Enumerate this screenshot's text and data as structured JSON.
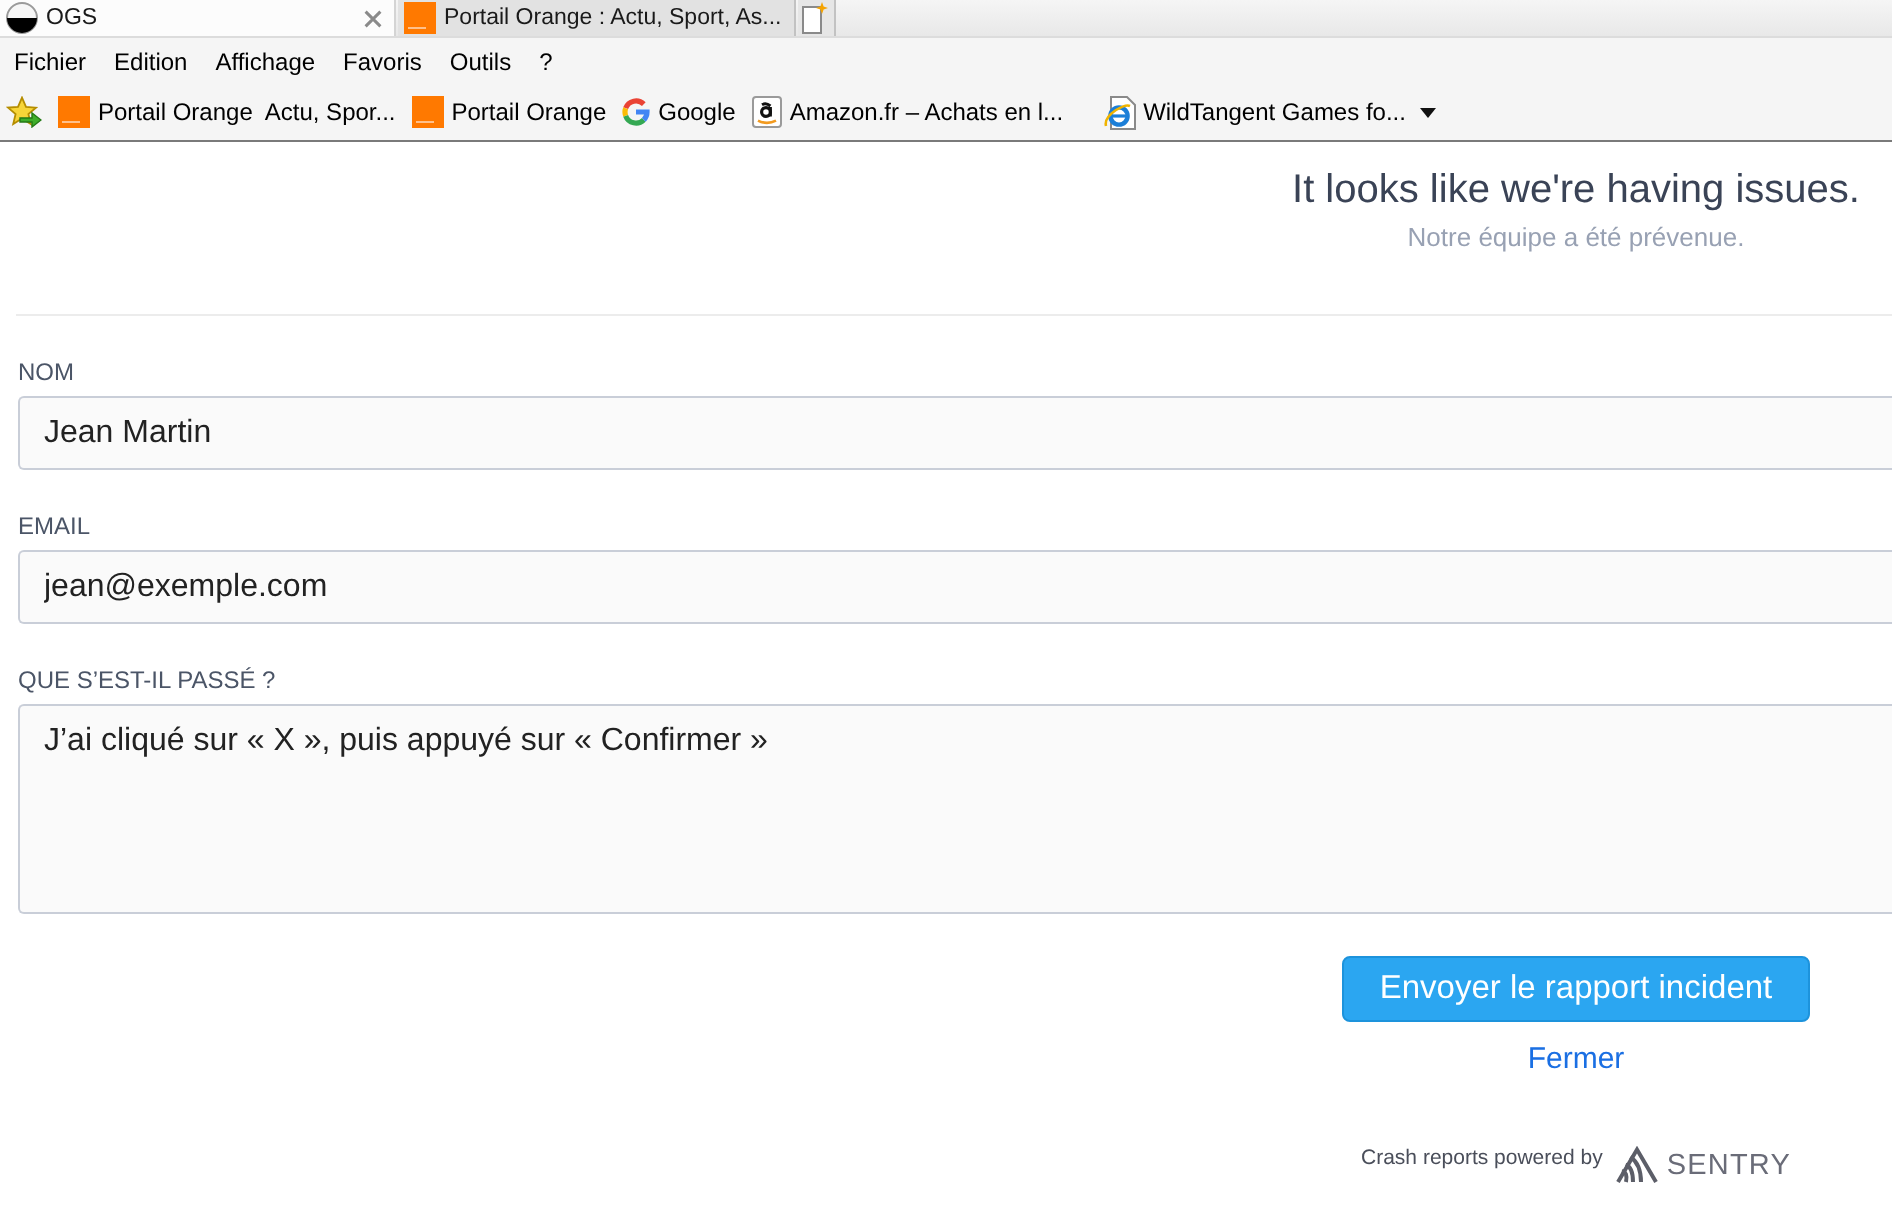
{
  "browser": {
    "tabs": [
      {
        "title": "OGS",
        "kind": "ogs",
        "selected": true
      },
      {
        "title": "Portail Orange : Actu, Sport, As...",
        "kind": "orange",
        "selected": false
      }
    ],
    "menu": [
      "Fichier",
      "Edition",
      "Affichage",
      "Favoris",
      "Outils",
      "?"
    ],
    "favorites": [
      {
        "label": "Portail Orange  Actu, Spor...",
        "kind": "orange"
      },
      {
        "label": "Portail Orange",
        "kind": "orange"
      },
      {
        "label": "Google",
        "kind": "google"
      },
      {
        "label": "Amazon.fr – Achats en l...",
        "kind": "amazon"
      },
      {
        "label": "WildTangent Games fo...",
        "kind": "ie"
      }
    ]
  },
  "header": {
    "title": "It looks like we're having issues.",
    "subtitle": "Notre équipe a été prévenue."
  },
  "form": {
    "fields": [
      {
        "label": "NOM",
        "value": "Jean Martin",
        "kind": "input"
      },
      {
        "label": "EMAIL",
        "value": "jean@exemple.com",
        "kind": "input"
      },
      {
        "label": "QUE S’EST-IL PASSÉ ?",
        "value": "J’ai cliqué sur « X », puis appuyé sur « Confirmer »",
        "kind": "textarea"
      }
    ]
  },
  "actions": {
    "submit": "Envoyer le rapport incident",
    "close": "Fermer"
  },
  "footer": {
    "text": "Crash reports powered by",
    "brand": "SENTRY"
  }
}
